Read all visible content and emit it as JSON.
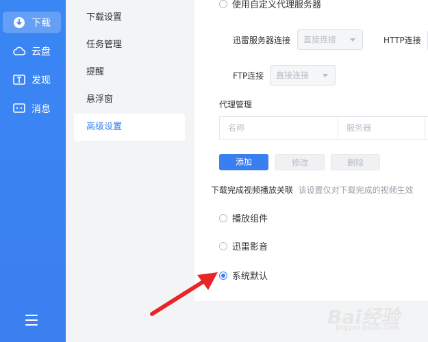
{
  "sidebar": {
    "items": [
      {
        "label": "下载",
        "icon": "download-icon",
        "active": true
      },
      {
        "label": "云盘",
        "icon": "cloud-icon"
      },
      {
        "label": "发现",
        "icon": "discover-icon"
      },
      {
        "label": "消息",
        "icon": "message-icon"
      }
    ],
    "menu_icon": "hamburger-menu-icon"
  },
  "subnav": {
    "items": [
      {
        "label": "下载设置"
      },
      {
        "label": "任务管理"
      },
      {
        "label": "提醒"
      },
      {
        "label": "悬浮窗"
      },
      {
        "label": "高级设置",
        "active": true
      }
    ]
  },
  "proxy": {
    "custom_proxy_label": "使用自定义代理服务器",
    "xunlei_server_label": "迅雷服务器连接",
    "xunlei_server_value": "直接连接",
    "http_label": "HTTP连接",
    "ftp_label": "FTP连接",
    "ftp_value": "直接连接",
    "management_label": "代理管理",
    "table_headers": [
      "名称",
      "服务器"
    ],
    "add_button": "添加",
    "edit_button": "修改",
    "delete_button": "删除"
  },
  "video_assoc": {
    "title": "下载完成视频播放关联",
    "hint": "该设置仅对下载完成的视频生效",
    "options": [
      {
        "label": "播放组件",
        "checked": false
      },
      {
        "label": "迅雷影音",
        "checked": false
      },
      {
        "label": "系统默认",
        "checked": true
      }
    ]
  },
  "watermark": {
    "main": "Bai经验",
    "sub": "jingyan.baidu.com"
  },
  "colors": {
    "accent": "#3a7ff0",
    "sidebar": "#3a86f5",
    "arrow": "#e8262a"
  }
}
